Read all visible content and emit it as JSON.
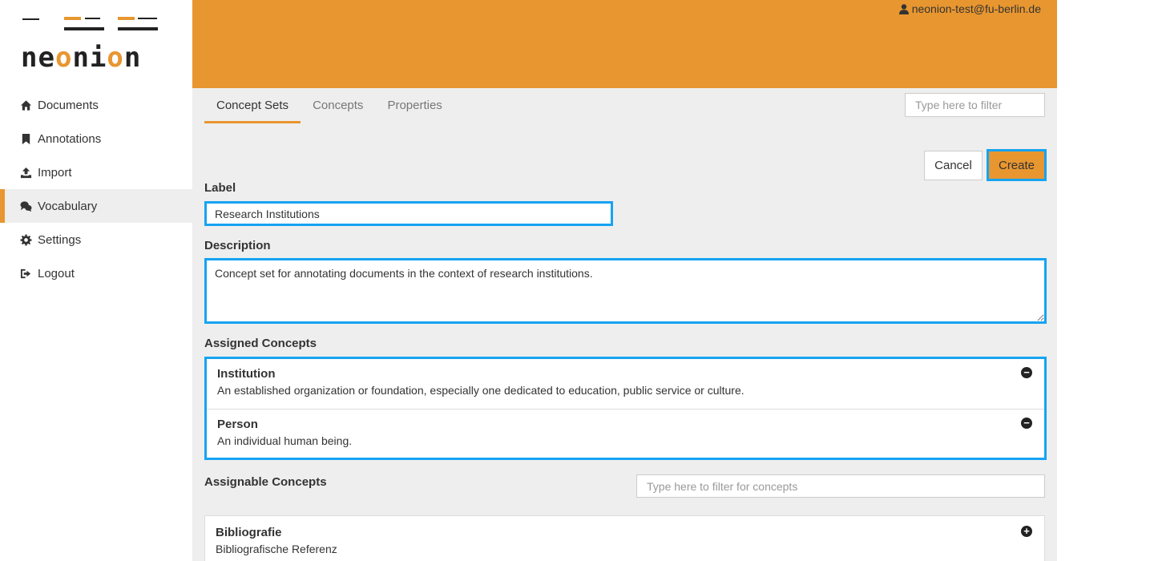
{
  "app": {
    "logo_text": "neonion",
    "accent_color": "#e8962f",
    "focus_color": "#16a3f2"
  },
  "header": {
    "user_email": "neonion-test@fu-berlin.de",
    "user_icon": "user-icon"
  },
  "sidebar": {
    "items": [
      {
        "label": "Documents",
        "icon": "home-icon"
      },
      {
        "label": "Annotations",
        "icon": "bookmark-icon"
      },
      {
        "label": "Import",
        "icon": "upload-icon"
      },
      {
        "label": "Vocabulary",
        "icon": "chat-bubbles-icon",
        "active": true
      },
      {
        "label": "Settings",
        "icon": "gear-icon"
      },
      {
        "label": "Logout",
        "icon": "sign-out-icon"
      }
    ]
  },
  "tabs": [
    {
      "label": "Concept Sets",
      "active": true
    },
    {
      "label": "Concepts"
    },
    {
      "label": "Properties"
    }
  ],
  "filter": {
    "placeholder": "Type here to filter"
  },
  "form": {
    "cancel_label": "Cancel",
    "create_label": "Create",
    "label_heading": "Label",
    "label_value": "Research Institutions",
    "description_heading": "Description",
    "description_value": "Concept set for annotating documents in the context of research institutions.",
    "assigned_heading": "Assigned Concepts",
    "assigned": [
      {
        "name": "Institution",
        "description": "An established organization or foundation, especially one dedicated to education, public service or culture."
      },
      {
        "name": "Person",
        "description": "An individual human being."
      }
    ],
    "assignable_heading": "Assignable Concepts",
    "assignable_filter_placeholder": "Type here to filter for concepts",
    "assignable": [
      {
        "name": "Bibliografie",
        "description": "Bibliografische Referenz"
      }
    ]
  }
}
